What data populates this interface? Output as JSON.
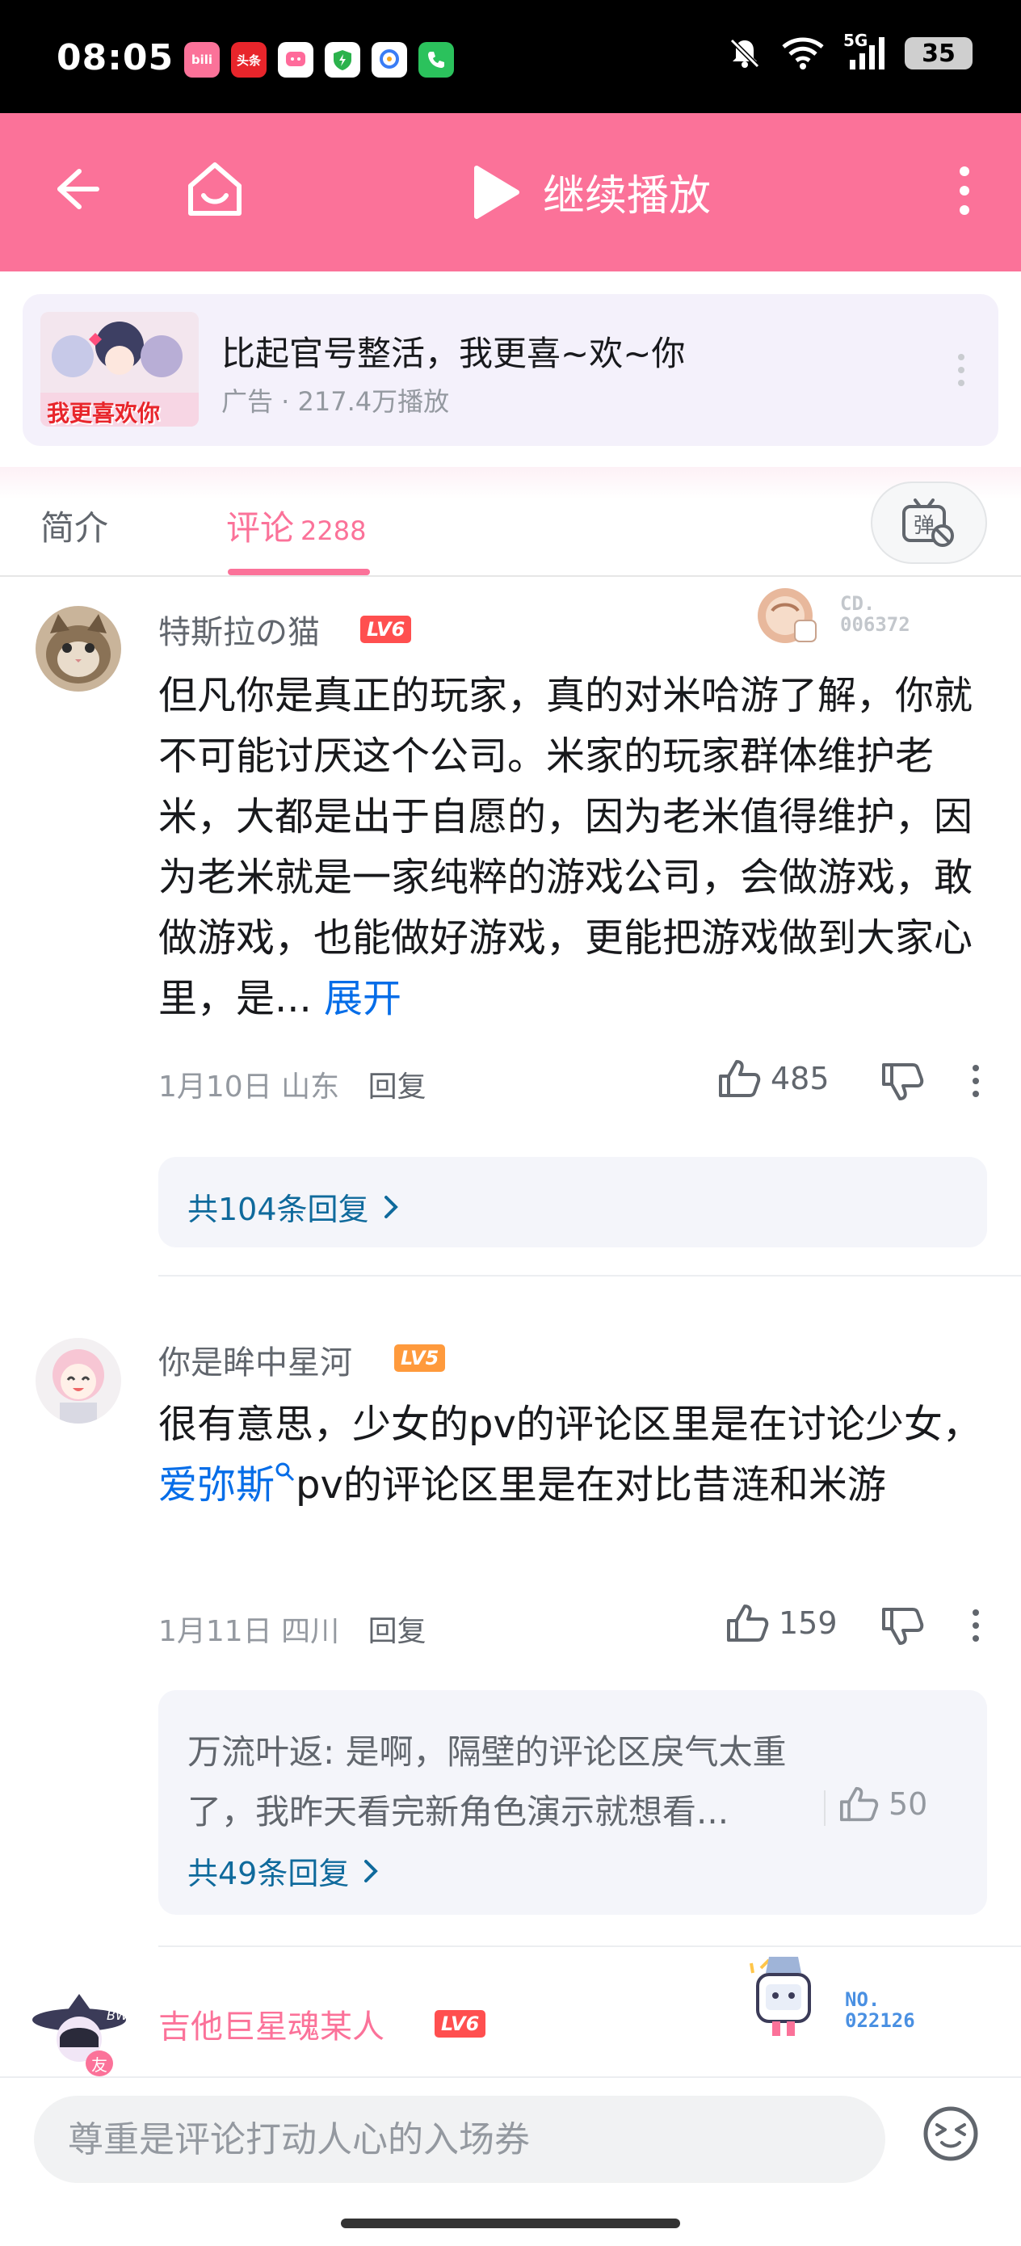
{
  "status_bar": {
    "time": "08:05",
    "apps": [
      {
        "name": "bilibili-app-icon",
        "label": "bili",
        "color": "#fb7299"
      },
      {
        "name": "toutiao-app-icon",
        "label": "头条",
        "color": "#e8252b"
      },
      {
        "name": "chat-app-icon",
        "label": "",
        "color": "#ffffff"
      },
      {
        "name": "security-app-icon",
        "label": "",
        "color": "#2bb24c"
      },
      {
        "name": "photos-app-icon",
        "label": "",
        "color": "#3a7df5"
      },
      {
        "name": "phone-app-icon",
        "label": "",
        "color": "#2bc25c"
      }
    ],
    "network": "5G",
    "battery": "35"
  },
  "top_bar": {
    "play_label": "继续播放",
    "color": "#fb7299"
  },
  "ad": {
    "title": "比起官号整活，我更喜~欢~你",
    "meta": "广告 · 217.4万播放",
    "thumb_caption": "我更喜欢你"
  },
  "tabs": {
    "intro": "简介",
    "comments": "评论",
    "comments_count": "2288"
  },
  "comments": [
    {
      "username": "特斯拉の猫",
      "level": "LV6",
      "badge_code": [
        "CD.",
        "006372"
      ],
      "text": "但凡你是真正的玩家，真的对米哈游了解，你就不可能讨厌这个公司。米家的玩家群体维护老米，大都是出于自愿的，因为老米值得维护，因为老米就是一家纯粹的游戏公司，会做游戏，敢做游戏，也能做好游戏，更能把游戏做到大家心里，是...",
      "expand": "展开",
      "date": "1月10日 山东",
      "reply": "回复",
      "likes": "485",
      "replies_total": "共104条回复"
    },
    {
      "username": "你是眸中星河",
      "level": "LV5",
      "text_before": "很有意思，少女的pv的评论区里是在讨论少女，",
      "link": "爱弥斯",
      "text_after": "pv的评论区里是在对比昔涟和米游",
      "date": "1月11日 四川",
      "reply": "回复",
      "likes": "159",
      "sub_reply": {
        "text": "万流叶返: 是啊，隔壁的评论区戾气太重了，我昨天看完新角色演示就想看...",
        "likes": "50"
      },
      "replies_total": "共49条回复"
    },
    {
      "username": "吉他巨星魂某人",
      "level": "LV6",
      "badge_code": [
        "NO.",
        "022126"
      ],
      "avatar_badge": "友"
    }
  ],
  "input": {
    "placeholder": "尊重是评论打动人心的入场券"
  }
}
